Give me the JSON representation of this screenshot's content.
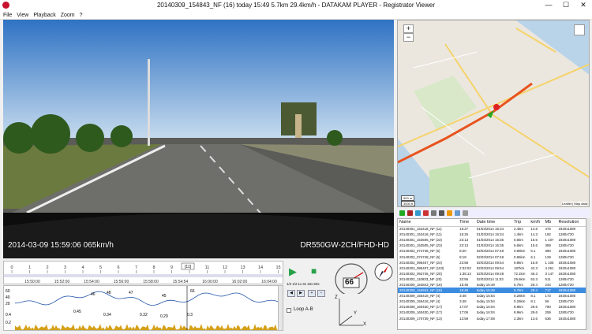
{
  "window": {
    "title": "20140309_154843_NF (16)   today 15:49   5.7km   29.4km/h  -  DATAKAM PLAYER - Registrator Viewer",
    "minimize": "—",
    "maximize": "☐",
    "close": "✕"
  },
  "menu": [
    "File",
    "View",
    "Playback",
    "Zoom",
    "?"
  ],
  "video": {
    "timestamp": "2014-03-09  15:59:06  065km/h",
    "device": "DR550GW-2CH/FHD-HD"
  },
  "map": {
    "zoom_in": "+",
    "zoom_out": "−",
    "scale_m": "500 m",
    "scale_ft": "3000 ft",
    "attribution": "Leaflet | Map data"
  },
  "filelist": {
    "headers": [
      "Name",
      "Time",
      "Date time",
      "Trip",
      "km/h",
      "Mb",
      "Resolution"
    ],
    "rows": [
      [
        "20140301_153418_NF (11)",
        "15:27",
        "01/03/2014 15:34",
        "2.4km",
        "14.8",
        "476",
        "1920x1080"
      ],
      [
        "20140301_153418_NF (11)",
        "16:26",
        "01/03/2014 15:34",
        "1.4km",
        "14.3",
        "182",
        "1280x720"
      ],
      [
        "20140301_153505_NF (23)",
        "23:13",
        "01/03/2014 15:35",
        "6.6km",
        "15.6",
        "1 107",
        "1920x1080"
      ],
      [
        "20140301_153505_NF (23)",
        "23:13",
        "01/03/2014 15:35",
        "6.6km",
        "15.6",
        "359",
        "1280x720"
      ],
      [
        "20140302_074748_NF (6)",
        "8:20",
        "02/03/2014 07:48",
        "0.86km",
        "6.1",
        "380",
        "1920x1080"
      ],
      [
        "20140302_074748_NF (6)",
        "8:18",
        "02/03/2014 07:48",
        "0.86km",
        "6.1",
        "129",
        "1280x720"
      ],
      [
        "20140302_095407_NF (24)",
        "23:58",
        "02/03/2014 09:54",
        "9.8km",
        "16.8",
        "1 105",
        "1920x1080"
      ],
      [
        "20140302_095407_NF (103)",
        "2:32:03",
        "02/03/2014 09:54",
        "187km",
        "42.3",
        "4 251",
        "1920x1080"
      ],
      [
        "20140302_092745_NF (20)",
        "1:35:13",
        "02/03/2014 09:28",
        "72.1km",
        "46.3",
        "3 147",
        "1920x1080"
      ],
      [
        "20140302_110833_NF (20)",
        "32:55",
        "02/03/2014 11:03",
        "29.6km",
        "53.3",
        "511",
        "1280x720"
      ],
      [
        "20140309_154843_NF (16)",
        "15:45",
        "today 15:49",
        "5.7km",
        "29.4",
        "244",
        "1280x720"
      ],
      [
        "20140309_154843_NF (16)",
        "15:45",
        "today 15:49",
        "5.7km",
        "29.4",
        "717",
        "1920x1080"
      ],
      [
        "20140309_155418_NF (4)",
        "3:48",
        "today 15:54",
        "0.26km",
        "8.1",
        "173",
        "1920x1080"
      ],
      [
        "20140309_155418_NF (4)",
        "3:48",
        "today 15:54",
        "0.26km",
        "8.1",
        "56",
        "1280x720"
      ],
      [
        "20140309_160430_NF (17)",
        "17:07",
        "today 16:04",
        "8.9km",
        "29.6",
        "780",
        "1920x1080"
      ],
      [
        "20140309_160430_NF (17)",
        "17:06",
        "today 16:04",
        "8.9km",
        "29.6",
        "259",
        "1280x720"
      ],
      [
        "20140309_170739_NF (13)",
        "13:59",
        "today 17:08",
        "2.3km",
        "13.6",
        "636",
        "1920x1080"
      ]
    ],
    "selected_index": 11
  },
  "timeline": {
    "labels": [
      "0",
      "1",
      "2",
      "3",
      "4",
      "5",
      "6",
      "7",
      "8",
      "9",
      "10",
      "11",
      "12",
      "13",
      "14",
      "15"
    ],
    "current": "[11]",
    "times": [
      "15:50:00",
      "15:52:00",
      "15:54:00",
      "15:56:00",
      "15:58:00",
      "15:54:54",
      "16:00:00",
      "16:02:00",
      "16:04:00"
    ]
  },
  "graph": {
    "y_top": [
      "60",
      "40",
      "20"
    ],
    "y_bottom": [
      "0.4",
      "0.2"
    ],
    "speed_labels": [
      "46",
      "48",
      "47",
      "45",
      "66"
    ],
    "g_labels": [
      "0.45",
      "0.34",
      "0.32",
      "0.29",
      "0.3"
    ]
  },
  "controls": {
    "play": "▶",
    "stop": "■",
    "rates": [
      "1/4",
      "1/2",
      "1x",
      "3x",
      "15x",
      "60x"
    ],
    "loop": "Loop A-B"
  },
  "speedometer": {
    "value": "66",
    "labels": [
      "20",
      "40",
      "60",
      "80",
      "100",
      "120"
    ]
  },
  "gsensor": {
    "labels": [
      "Z",
      "X",
      "Y"
    ]
  },
  "colors": {
    "accent": "#3c8de0",
    "route": "#e8531e",
    "speed_line": "#2255aa",
    "g_fill": "#d4a017"
  }
}
